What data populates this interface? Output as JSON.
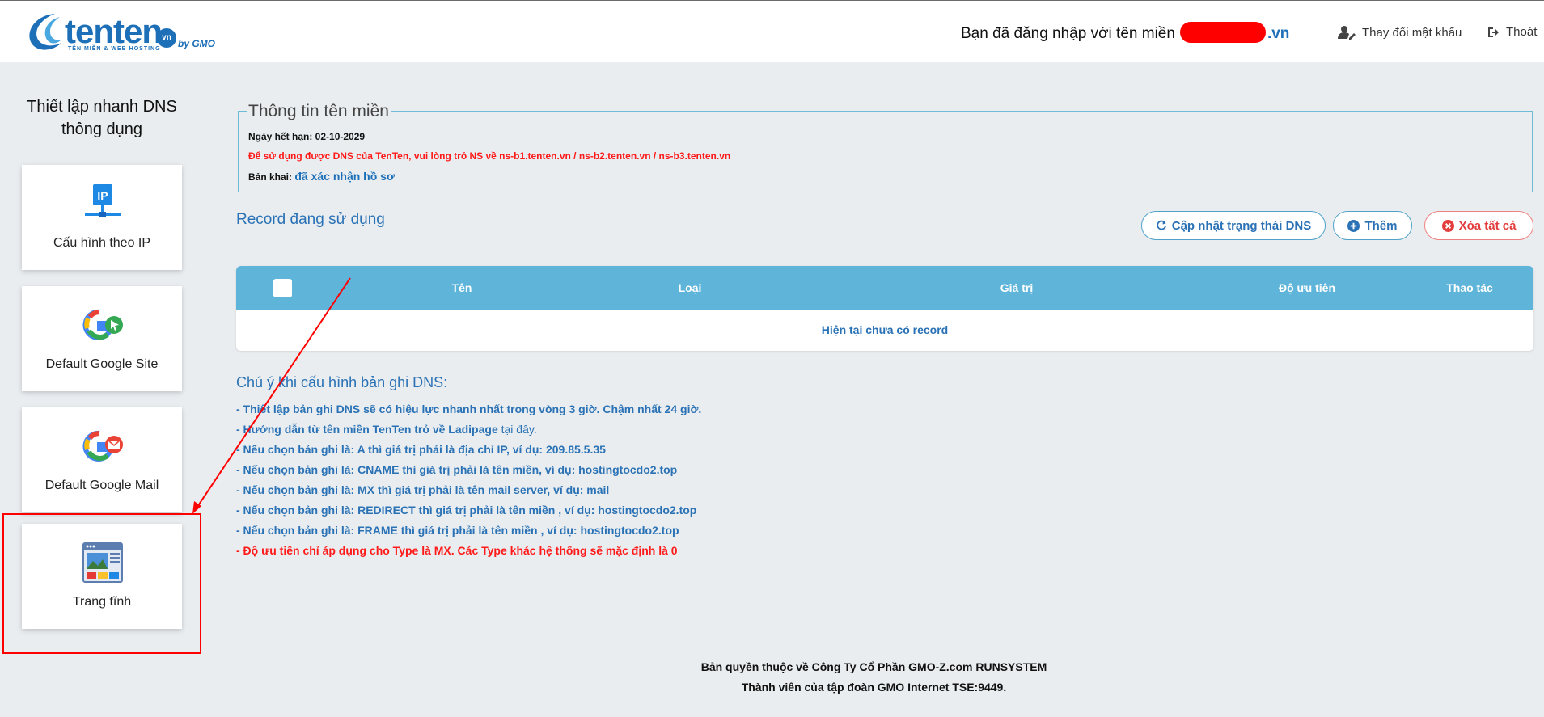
{
  "header": {
    "logo": {
      "word": "tenten",
      "badge": "vn",
      "gmo": "by GMO",
      "tagline": "TÊN MIỀN & WEB HOSTING"
    },
    "login_prefix": "Bạn đã đăng nhập với tên miền",
    "login_domain_suffix": ".vn",
    "change_password": "Thay đổi mật khẩu",
    "logout": "Thoát"
  },
  "sidebar": {
    "title_line1": "Thiết lập nhanh DNS",
    "title_line2": "thông dụng",
    "cards": [
      {
        "label": "Cấu hình theo IP",
        "icon": "ip-network-icon"
      },
      {
        "label": "Default Google Site",
        "icon": "google-site-icon"
      },
      {
        "label": "Default Google Mail",
        "icon": "google-mail-icon"
      },
      {
        "label": "Trang tĩnh",
        "icon": "static-page-icon"
      }
    ]
  },
  "domain_info": {
    "legend": "Thông tin tên miền",
    "expiry_label": "Ngày hết hạn: 02-10-2029",
    "warning": "Để sử dụng được DNS của TenTen, vui lòng trỏ NS về ns-b1.tenten.vn / ns-b2.tenten.vn / ns-b3.tenten.vn",
    "declaration_label": "Bản khai:",
    "declaration_value": "đã xác nhận hồ sơ"
  },
  "records": {
    "title": "Record đang sử dụng",
    "update_button": "Cập nhật trạng thái DNS",
    "add_button": "Thêm",
    "delete_all_button": "Xóa tất cả",
    "columns": [
      "Tên",
      "Loại",
      "Giá trị",
      "Độ ưu tiên",
      "Thao tác"
    ],
    "empty_text": "Hiện tại chưa có record"
  },
  "notes": {
    "title": "Chú ý khi cấu hình bản ghi DNS:",
    "line1": "- Thiết lập bản ghi DNS sẽ có hiệu lực nhanh nhất trong vòng 3 giờ. Chậm nhất 24 giờ.",
    "line2_prefix": "- Hướng dẫn từ tên miền TenTen trỏ về Ladipage",
    "line2_link": "tại đây.",
    "line3": "- Nếu chọn bản ghi là: A thì giá trị phải là địa chỉ IP, ví dụ: 209.85.5.35",
    "line4": "- Nếu chọn bản ghi là: CNAME thì giá trị phải là tên miền, ví dụ: hostingtocdo2.top",
    "line5": "- Nếu chọn bản ghi là: MX thì giá trị phải là tên mail server, ví dụ: mail",
    "line6": "- Nếu chọn bản ghi là: REDIRECT thì giá trị phải là tên miền , ví dụ: hostingtocdo2.top",
    "line7": "- Nếu chọn bản ghi là: FRAME thì giá trị phải là tên miền , ví dụ: hostingtocdo2.top",
    "line8": "- Độ ưu tiên chỉ áp dụng cho Type là MX. Các Type khác hệ thống sẽ mặc định là 0"
  },
  "footer": {
    "line1": "Bản quyền thuộc về Công Ty Cổ Phần GMO-Z.com RUNSYSTEM",
    "line2": "Thành viên của tập đoàn GMO Internet TSE:9449."
  },
  "colors": {
    "brand": "#1d6fb8",
    "table_header": "#5eb4d9",
    "warning": "#ff1a1a",
    "annotation": "#ff0000"
  }
}
